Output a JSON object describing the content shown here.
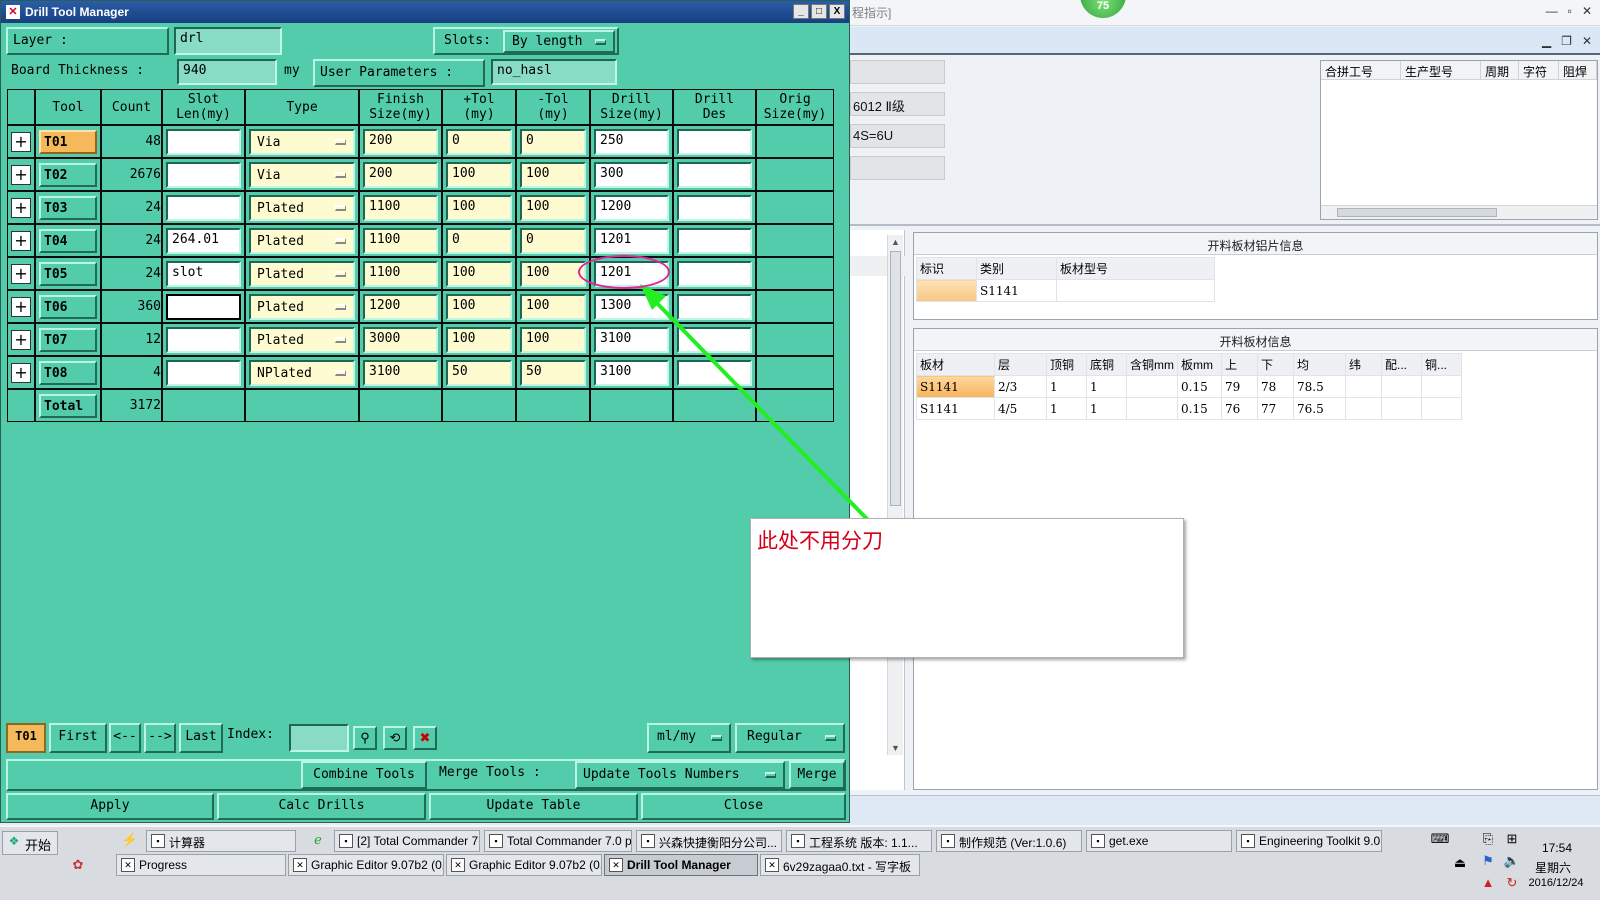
{
  "background_app": {
    "title": "程指示]",
    "fields": [
      "",
      "6012 Ⅱ级",
      "4S=6U",
      ""
    ],
    "grid_top": {
      "headers": [
        "合拼工号",
        "生产型号",
        "周期",
        "字符",
        "阻焊"
      ]
    },
    "panel1": {
      "title": "开料板材铝片信息",
      "headers": [
        "标识",
        "类别",
        "板材型号"
      ],
      "rows": [
        [
          "",
          "S1141",
          ""
        ]
      ]
    },
    "panel2": {
      "title": "开料板材信息",
      "headers": [
        "板材",
        "层",
        "顶铜",
        "底铜",
        "含铜mm",
        "板mm",
        "上",
        "下",
        "均",
        "纬",
        "配...",
        "铜..."
      ],
      "rows": [
        [
          "S1141",
          "2/3",
          "1",
          "1",
          "",
          "0.15",
          "79",
          "78",
          "78.5",
          "",
          "",
          ""
        ],
        [
          "S1141",
          "4/5",
          "1",
          "1",
          "",
          "0.15",
          "76",
          "77",
          "76.5",
          "",
          "",
          ""
        ]
      ]
    },
    "badge": "75"
  },
  "window": {
    "title": "Drill Tool Manager",
    "buttons": {
      "minimize": "_",
      "maximize": "□",
      "close": "X"
    }
  },
  "form": {
    "layer_label": "Layer          :",
    "layer_value": "drl",
    "slots_label": "Slots:",
    "slots_value": "By length",
    "board_thickness_label": "Board Thickness :",
    "board_thickness_value": "940",
    "board_thickness_unit": "my",
    "user_params_label": "User Parameters :",
    "user_params_value": "no_hasl"
  },
  "table": {
    "headers": {
      "tool": "Tool",
      "count": "Count",
      "slot_len": [
        "Slot",
        "Len(my)"
      ],
      "type": "Type",
      "finish_size": [
        "Finish",
        "Size(my)"
      ],
      "plus_tol": [
        "+Tol",
        "(my)"
      ],
      "minus_tol": [
        "-Tol",
        "(my)"
      ],
      "drill_size": [
        "Drill",
        "Size(my)"
      ],
      "drill_des": [
        "Drill",
        "Des"
      ],
      "orig_size": [
        "Orig",
        "Size(my)"
      ]
    },
    "rows": [
      {
        "tool": "T01",
        "count": "48",
        "slot_len": "",
        "type": "Via",
        "finish": "200",
        "plus_tol": "0",
        "minus_tol": "0",
        "drill": "250",
        "des": ""
      },
      {
        "tool": "T02",
        "count": "2676",
        "slot_len": "",
        "type": "Via",
        "finish": "200",
        "plus_tol": "100",
        "minus_tol": "100",
        "drill": "300",
        "des": ""
      },
      {
        "tool": "T03",
        "count": "24",
        "slot_len": "",
        "type": "Plated",
        "finish": "1100",
        "plus_tol": "100",
        "minus_tol": "100",
        "drill": "1200",
        "des": ""
      },
      {
        "tool": "T04",
        "count": "24",
        "slot_len": "264.01",
        "type": "Plated",
        "finish": "1100",
        "plus_tol": "0",
        "minus_tol": "0",
        "drill": "1201",
        "des": ""
      },
      {
        "tool": "T05",
        "count": "24",
        "slot_len": "slot",
        "type": "Plated",
        "finish": "1100",
        "plus_tol": "100",
        "minus_tol": "100",
        "drill": "1201",
        "des": ""
      },
      {
        "tool": "T06",
        "count": "360",
        "slot_len": "",
        "type": "Plated",
        "finish": "1200",
        "plus_tol": "100",
        "minus_tol": "100",
        "drill": "1300",
        "des": ""
      },
      {
        "tool": "T07",
        "count": "12",
        "slot_len": "",
        "type": "Plated",
        "finish": "3000",
        "plus_tol": "100",
        "minus_tol": "100",
        "drill": "3100",
        "des": ""
      },
      {
        "tool": "T08",
        "count": "4",
        "slot_len": "",
        "type": "NPlated",
        "finish": "3100",
        "plus_tol": "50",
        "minus_tol": "50",
        "drill": "3100",
        "des": ""
      }
    ],
    "total_label": "Total",
    "total_count": "3172"
  },
  "nav": {
    "current": "T01",
    "first": "First",
    "prev": "<--",
    "next": "-->",
    "last": "Last",
    "index_label": "Index:",
    "units": "ml/my",
    "mode": "Regular"
  },
  "actions": {
    "combine": "Combine Tools",
    "merge_label": "Merge Tools :",
    "update_numbers": "Update Tools Numbers",
    "merge": "Merge",
    "apply": "Apply",
    "calc": "Calc Drills",
    "update_table": "Update Table",
    "close": "Close"
  },
  "annotation": {
    "text": "此处不用分刀",
    "color": "#d4001a",
    "circle_color": "#e0259a",
    "arrow_color": "#22ee22"
  },
  "taskbar": {
    "start": "开始",
    "row1": [
      "计算器",
      "[2] Total Commander 7...",
      "Total Commander 7.0 p...",
      "兴森快捷衡阳分公司...",
      "工程系统  版本: 1.1...",
      "制作规范 (Ver:1.0.6)",
      "get.exe",
      "Engineering Toolkit 9.0..."
    ],
    "row2": [
      "Progress",
      "Graphic Editor 9.07b2 (0...",
      "Graphic Editor 9.07b2 (0...",
      "Drill Tool Manager",
      "6v29zagaa0.txt - 写字板"
    ],
    "time": "17:54",
    "weekday": "星期六",
    "date": "2016/12/24"
  },
  "colors": {
    "window_bg": "#52ccaa",
    "selected_tool": "#f5b85a",
    "titlebar": "#1d4a92"
  }
}
